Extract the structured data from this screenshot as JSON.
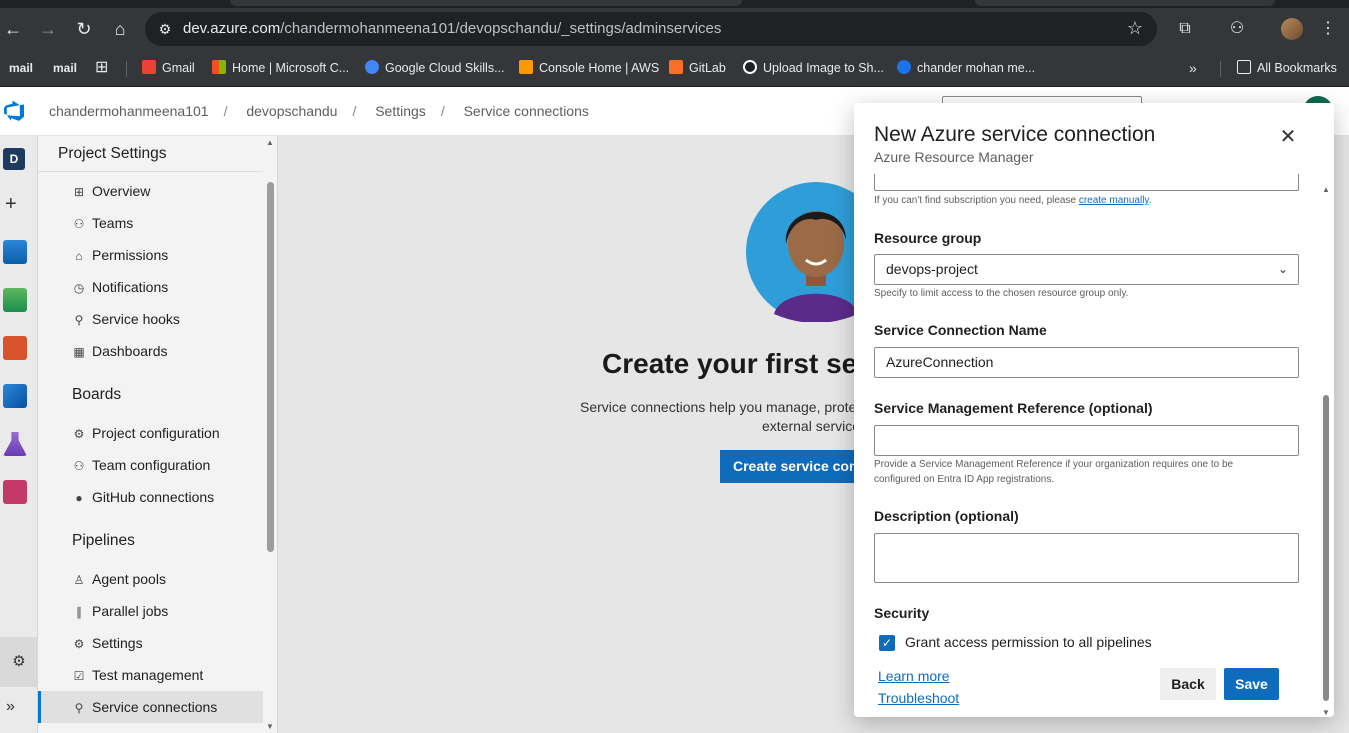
{
  "browser": {
    "url_host": "dev.azure.com",
    "url_path": "/chandermohanmeena101/devopschandu/_settings/adminservices",
    "bookmarks": [
      {
        "label": "mail",
        "kind": "chip"
      },
      {
        "label": "mail",
        "kind": "chip"
      },
      {
        "label": "Gmail",
        "color": "#ea4335"
      },
      {
        "label": "Home | Microsoft C...",
        "color": "#f25022"
      },
      {
        "label": "Google Cloud Skills...",
        "color": "#4285f4"
      },
      {
        "label": "Console Home | AWS",
        "color": "#ff9900"
      },
      {
        "label": "GitLab",
        "color": "#fc6d26"
      },
      {
        "label": "Upload Image to Sh...",
        "color": "#ffffff"
      },
      {
        "label": "chander mohan me...",
        "color": "#1a73e8"
      }
    ],
    "all_bookmarks": "All Bookmarks"
  },
  "header": {
    "breadcrumbs": [
      "chandermohanmeena101",
      "devopschandu",
      "Settings",
      "Service connections"
    ]
  },
  "rail": {
    "project_initial": "D"
  },
  "sidebar": {
    "title": "Project Settings",
    "general": [
      {
        "label": "Overview",
        "icon": "grid-icon",
        "glyph": "⊞"
      },
      {
        "label": "Teams",
        "icon": "teams-icon",
        "glyph": "⚇"
      },
      {
        "label": "Permissions",
        "icon": "lock-icon",
        "glyph": "⌂"
      },
      {
        "label": "Notifications",
        "icon": "chat-icon",
        "glyph": "◷"
      },
      {
        "label": "Service hooks",
        "icon": "hook-icon",
        "glyph": "⚲"
      },
      {
        "label": "Dashboards",
        "icon": "dashboard-icon",
        "glyph": "▦"
      }
    ],
    "boards_title": "Boards",
    "boards": [
      {
        "label": "Project configuration",
        "icon": "config-icon",
        "glyph": "⚙"
      },
      {
        "label": "Team configuration",
        "icon": "team-config-icon",
        "glyph": "⚇"
      },
      {
        "label": "GitHub connections",
        "icon": "github-icon",
        "glyph": "●"
      }
    ],
    "pipelines_title": "Pipelines",
    "pipelines": [
      {
        "label": "Agent pools",
        "icon": "agent-icon",
        "glyph": "♙"
      },
      {
        "label": "Parallel jobs",
        "icon": "parallel-icon",
        "glyph": "∥"
      },
      {
        "label": "Settings",
        "icon": "gear-icon",
        "glyph": "⚙"
      },
      {
        "label": "Test management",
        "icon": "test-icon",
        "glyph": "☑"
      },
      {
        "label": "Service connections",
        "icon": "plug-icon",
        "glyph": "⚲",
        "selected": true
      }
    ]
  },
  "main": {
    "title": "Create your first serv",
    "desc_line1": "Service connections help you manage, prote",
    "desc_line2": "external service",
    "button": "Create service conn"
  },
  "dialog": {
    "title": "New Azure service connection",
    "subtitle": "Azure Resource Manager",
    "subscription_hint": "If you can't find subscription you need, please",
    "subscription_hint_link": "create manually",
    "resource_group_label": "Resource group",
    "resource_group_value": "devops-project",
    "resource_group_hint": "Specify to limit access to the chosen resource group only.",
    "name_label": "Service Connection Name",
    "name_value": "AzureConnection",
    "smr_label": "Service Management Reference (optional)",
    "smr_value": "",
    "smr_hint_line1": "Provide a Service Management Reference if your organization requires one to be",
    "smr_hint_line2": "configured on Entra ID App registrations.",
    "description_label": "Description (optional)",
    "security_label": "Security",
    "grant_access_label": "Grant access permission to all pipelines",
    "grant_access_checked": true,
    "learn_more": "Learn more",
    "troubleshoot": "Troubleshoot",
    "back_button": "Back",
    "save_button": "Save"
  }
}
